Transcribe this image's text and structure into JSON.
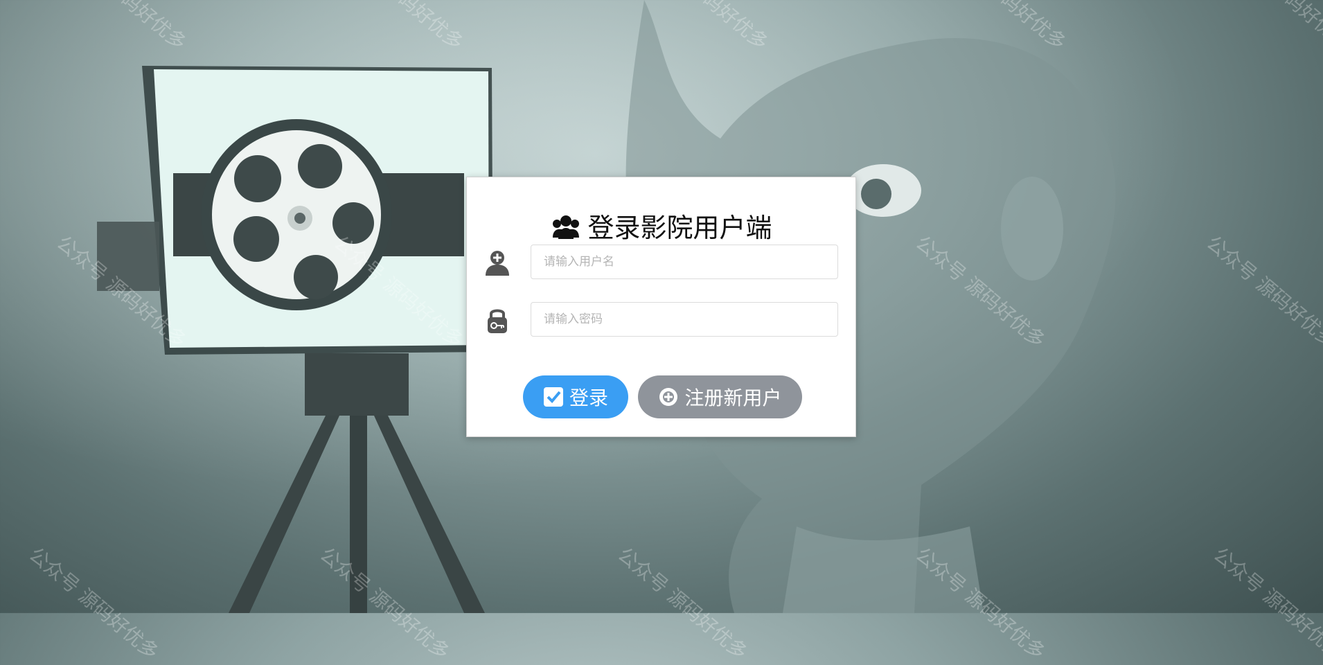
{
  "login": {
    "title": "登录影院用户端",
    "username_placeholder": "请输入用户名",
    "password_placeholder": "请输入密码",
    "login_label": "登录",
    "register_label": "注册新用户"
  },
  "watermark": {
    "text": "公众号 源码好优多"
  },
  "colors": {
    "login_button": "#3a9ef3",
    "register_button": "#8f949b",
    "background": "#6f8585"
  },
  "icons": {
    "title": "users-group-icon",
    "username": "user-add-icon",
    "password": "lock-key-icon",
    "login": "checkbox-icon",
    "register": "plus-circle-icon"
  }
}
